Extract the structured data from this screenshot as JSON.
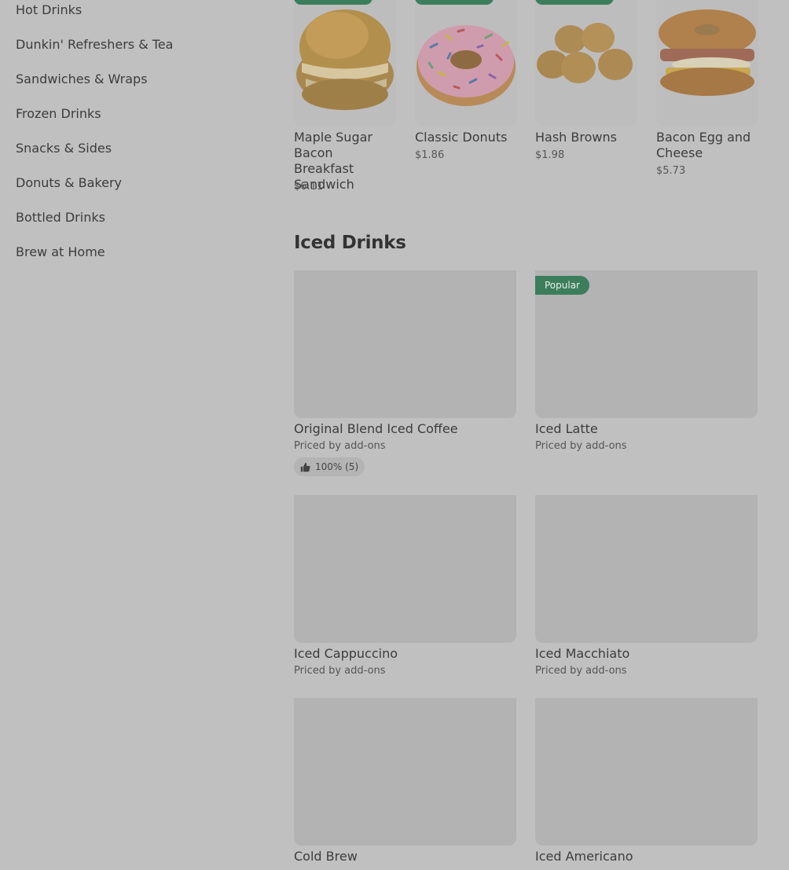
{
  "sidebar": {
    "categories": [
      "Hot Drinks",
      "Dunkin' Refreshers & Tea",
      "Sandwiches & Wraps",
      "Frozen Drinks",
      "Snacks & Sides",
      "Donuts & Bakery",
      "Bottled Drinks",
      "Brew at Home"
    ]
  },
  "featured": [
    {
      "name": "Maple Sugar Bacon Breakfast Sandwich",
      "price": "$6.11",
      "icon": "croissant-sandwich"
    },
    {
      "name": "Classic Donuts",
      "price": "$1.86",
      "icon": "sprinkle-donut"
    },
    {
      "name": "Hash Browns",
      "price": "$1.98",
      "icon": "hash-browns"
    },
    {
      "name": "Bacon Egg and Cheese",
      "price": "$5.73",
      "icon": "bagel-sandwich"
    }
  ],
  "iced_section": {
    "title": "Iced Drinks",
    "items": [
      {
        "name": "Original Blend Iced Coffee",
        "sub": "Priced by add-ons",
        "rating": "100% (5)"
      },
      {
        "name": "Iced Latte",
        "sub": "Priced by add-ons",
        "badge": "Popular"
      },
      {
        "name": "Iced Cappuccino",
        "sub": "Priced by add-ons"
      },
      {
        "name": "Iced Macchiato",
        "sub": "Priced by add-ons"
      },
      {
        "name": "Cold Brew",
        "sub": ""
      },
      {
        "name": "Iced Americano",
        "sub": ""
      }
    ]
  },
  "colors": {
    "overlay_bg": "#c0c0c0",
    "badge_green": "#3c7d5c"
  }
}
